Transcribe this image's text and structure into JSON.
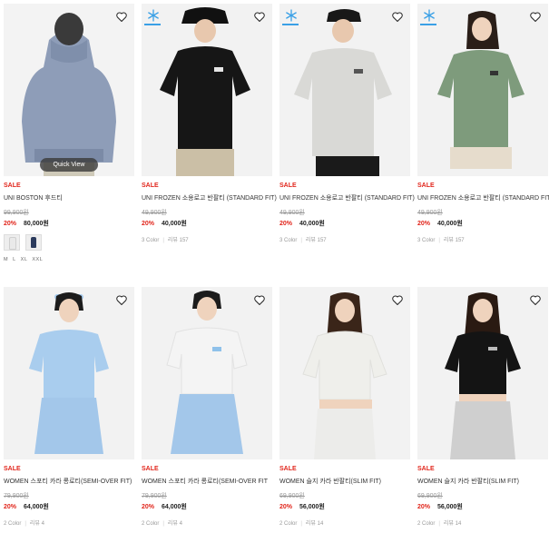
{
  "products": [
    {
      "sale": "SALE",
      "title": "UNI BOSTON 후드티",
      "original_price": "99,900원",
      "discount": "20%",
      "price": "80,000원",
      "quick_view": "Quick View",
      "swatches": [
        "#e9e9e9",
        "#2b3a5c"
      ],
      "sizes": [
        "M",
        "L",
        "XL",
        "XXL"
      ],
      "frozen": false,
      "model_color": "#8e9db8"
    },
    {
      "sale": "SALE",
      "title": "UNI FROZEN 소용로고 반팔티 (STANDARD FIT)",
      "original_price": "49,900원",
      "discount": "20%",
      "price": "40,000원",
      "color_count": "3 Color",
      "review": "리뷰 157",
      "frozen": true,
      "model_color": "#161616"
    },
    {
      "sale": "SALE",
      "title": "UNI FROZEN 소용로고 반팔티 (STANDARD FIT)",
      "original_price": "49,900원",
      "discount": "20%",
      "price": "40,000원",
      "color_count": "3 Color",
      "review": "리뷰 157",
      "frozen": true,
      "model_color": "#d9d9d6"
    },
    {
      "sale": "SALE",
      "title": "UNI FROZEN 소용로고 반팔티 (STANDARD FIT)",
      "original_price": "49,900원",
      "discount": "20%",
      "price": "40,000원",
      "color_count": "3 Color",
      "review": "리뷰 157",
      "frozen": true,
      "model_color": "#7e9b7c"
    },
    {
      "sale": "SALE",
      "title": "WOMEN 스포티 카라 롱로티(SEMI-OVER FIT)",
      "original_price": "79,900원",
      "discount": "20%",
      "price": "64,000원",
      "color_count": "2 Color",
      "review": "리뷰 4",
      "frozen": false,
      "model_color": "#a9cdee"
    },
    {
      "sale": "SALE",
      "title": "WOMEN 스포티 카라 롱로티(SEMI-OVER FIT",
      "original_price": "79,900원",
      "discount": "20%",
      "price": "64,000원",
      "color_count": "2 Color",
      "review": "리뷰 4",
      "frozen": false,
      "model_color": "#f4f4f4"
    },
    {
      "sale": "SALE",
      "title": "WOMEN 슬지 카라 반팔티(SLIM FIT)",
      "original_price": "69,900원",
      "discount": "20%",
      "price": "56,000원",
      "color_count": "2 Color",
      "review": "리뷰 14",
      "frozen": false,
      "model_color": "#efefeb"
    },
    {
      "sale": "SALE",
      "title": "WOMEN 슬지 카라 반팔티(SLIM FIT)",
      "original_price": "69,900원",
      "discount": "20%",
      "price": "56,000원",
      "color_count": "2 Color",
      "review": "리뷰 14",
      "frozen": false,
      "model_color": "#141414"
    }
  ],
  "colors": {
    "sale_red": "#e1251b",
    "frozen_blue": "#3aa0e6",
    "muted_text": "#999999"
  },
  "icons": {
    "wishlist": "heart-outline-icon",
    "frozen_badge": "snowflake-icon"
  }
}
